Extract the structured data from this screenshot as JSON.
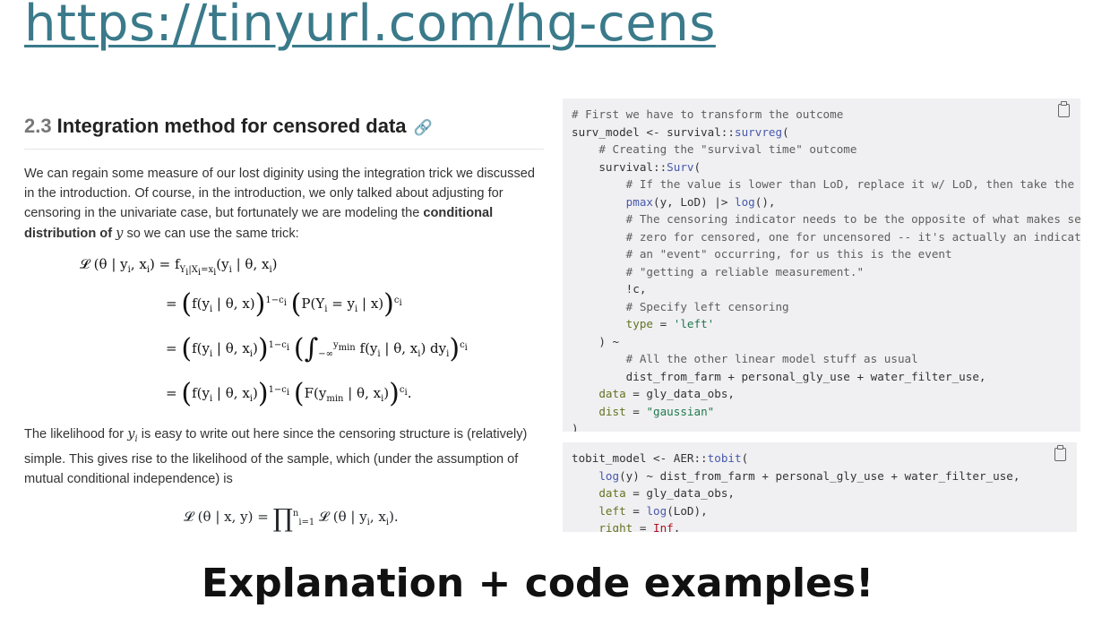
{
  "url": "https://tinyurl.com/hg-cens",
  "section": {
    "number": "2.3",
    "title": "Integration method for censored data",
    "anchor_icon": "link-icon"
  },
  "para1": {
    "text": "We can regain some measure of our lost diginity using the integration trick we discussed in the introduction. Of course, in the introduction, we only talked about adjusting for censoring in the univariate case, but fortunately we are modeling the",
    "bold": "conditional distribution of",
    "math": "y",
    "tail": "so we can use the same trick:"
  },
  "para2": {
    "pre": "The likelihood for",
    "math": "y",
    "sub": "i",
    "post": "is easy to write out here since the censoring structure is (relatively) simple. This gives rise to the likelihood of the sample, which (under the assumption of mutual conditional independence) is"
  },
  "code1_lines": [
    [
      {
        "c": "cm",
        "t": "# First we have to transform the outcome"
      }
    ],
    [
      {
        "c": "",
        "t": "surv_model <- survival::"
      },
      {
        "c": "fn",
        "t": "survreg"
      },
      {
        "c": "",
        "t": "("
      }
    ],
    [
      {
        "c": "cm",
        "t": "    # Creating the \"survival time\" outcome"
      }
    ],
    [
      {
        "c": "",
        "t": "    survival::"
      },
      {
        "c": "fn",
        "t": "Surv"
      },
      {
        "c": "",
        "t": "("
      }
    ],
    [
      {
        "c": "cm",
        "t": "        # If the value is lower than LoD, replace it w/ LoD, then take the log"
      }
    ],
    [
      {
        "c": "",
        "t": "        "
      },
      {
        "c": "fn",
        "t": "pmax"
      },
      {
        "c": "",
        "t": "(y, LoD) |> "
      },
      {
        "c": "fn",
        "t": "log"
      },
      {
        "c": "",
        "t": "(),"
      }
    ],
    [
      {
        "c": "cm",
        "t": "        # The censoring indicator needs to be the opposite of what makes sense"
      }
    ],
    [
      {
        "c": "cm",
        "t": "        # zero for censored, one for uncensored -- it's actually an indicator of"
      }
    ],
    [
      {
        "c": "cm",
        "t": "        # an \"event\" occurring, for us this is the event"
      }
    ],
    [
      {
        "c": "cm",
        "t": "        # \"getting a reliable measurement.\""
      }
    ],
    [
      {
        "c": "",
        "t": "        !c,"
      }
    ],
    [
      {
        "c": "cm",
        "t": "        # Specify left censoring"
      }
    ],
    [
      {
        "c": "",
        "t": "        "
      },
      {
        "c": "arg",
        "t": "type"
      },
      {
        "c": "",
        "t": " = "
      },
      {
        "c": "str",
        "t": "'left'"
      }
    ],
    [
      {
        "c": "",
        "t": "    ) ~"
      }
    ],
    [
      {
        "c": "cm",
        "t": "        # All the other linear model stuff as usual"
      }
    ],
    [
      {
        "c": "",
        "t": "        dist_from_farm + personal_gly_use + water_filter_use,"
      }
    ],
    [
      {
        "c": "",
        "t": "    "
      },
      {
        "c": "arg",
        "t": "data"
      },
      {
        "c": "",
        "t": " = gly_data_obs,"
      }
    ],
    [
      {
        "c": "",
        "t": "    "
      },
      {
        "c": "arg",
        "t": "dist"
      },
      {
        "c": "",
        "t": " = "
      },
      {
        "c": "str",
        "t": "\"gaussian\""
      }
    ],
    [
      {
        "c": "",
        "t": ")"
      }
    ]
  ],
  "code2_lines": [
    [
      {
        "c": "",
        "t": "tobit_model <- AER::"
      },
      {
        "c": "fn",
        "t": "tobit"
      },
      {
        "c": "",
        "t": "("
      }
    ],
    [
      {
        "c": "",
        "t": "    "
      },
      {
        "c": "fn",
        "t": "log"
      },
      {
        "c": "",
        "t": "(y) ~ dist_from_farm + personal_gly_use + water_filter_use,"
      }
    ],
    [
      {
        "c": "",
        "t": "    "
      },
      {
        "c": "arg",
        "t": "data"
      },
      {
        "c": "",
        "t": " = gly_data_obs,"
      }
    ],
    [
      {
        "c": "",
        "t": "    "
      },
      {
        "c": "arg",
        "t": "left"
      },
      {
        "c": "",
        "t": " = "
      },
      {
        "c": "fn",
        "t": "log"
      },
      {
        "c": "",
        "t": "(LoD),"
      }
    ],
    [
      {
        "c": "",
        "t": "    "
      },
      {
        "c": "arg",
        "t": "right"
      },
      {
        "c": "",
        "t": " = "
      },
      {
        "c": "kw",
        "t": "Inf"
      },
      {
        "c": "",
        "t": ","
      }
    ]
  ],
  "copy_icon": "clipboard-icon",
  "footer": "Explanation + code examples!"
}
